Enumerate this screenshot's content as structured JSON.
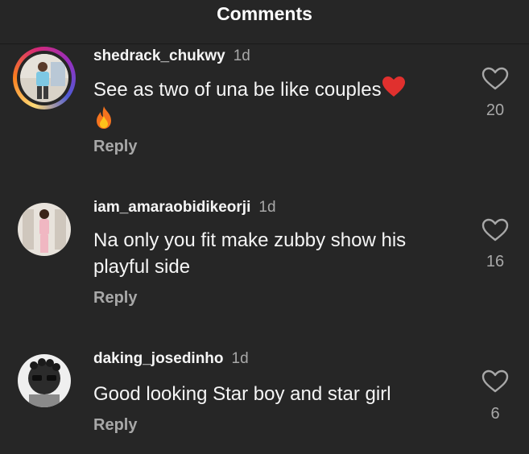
{
  "header": {
    "title": "Comments"
  },
  "comments": [
    {
      "username": "shedrack_chukwy",
      "time": "1d",
      "text": "See as two of una be like couples",
      "emoji_icons": [
        "red-heart-icon",
        "fire-icon"
      ],
      "reply_label": "Reply",
      "likes": "20",
      "avatar_ring": true
    },
    {
      "username": "iam_amaraobidikeorji",
      "time": "1d",
      "text": "Na only you fit make zubby show his playful side",
      "reply_label": "Reply",
      "likes": "16",
      "avatar_ring": false
    },
    {
      "username": "daking_josedinho",
      "time": "1d",
      "text": "Good looking Star boy and star girl",
      "reply_label": "Reply",
      "likes": "6",
      "avatar_ring": false
    }
  ],
  "colors": {
    "background": "#262626",
    "text_primary": "#f5f5f5",
    "text_secondary": "#a8a8a8",
    "heart_emoji": "#e0302e"
  }
}
